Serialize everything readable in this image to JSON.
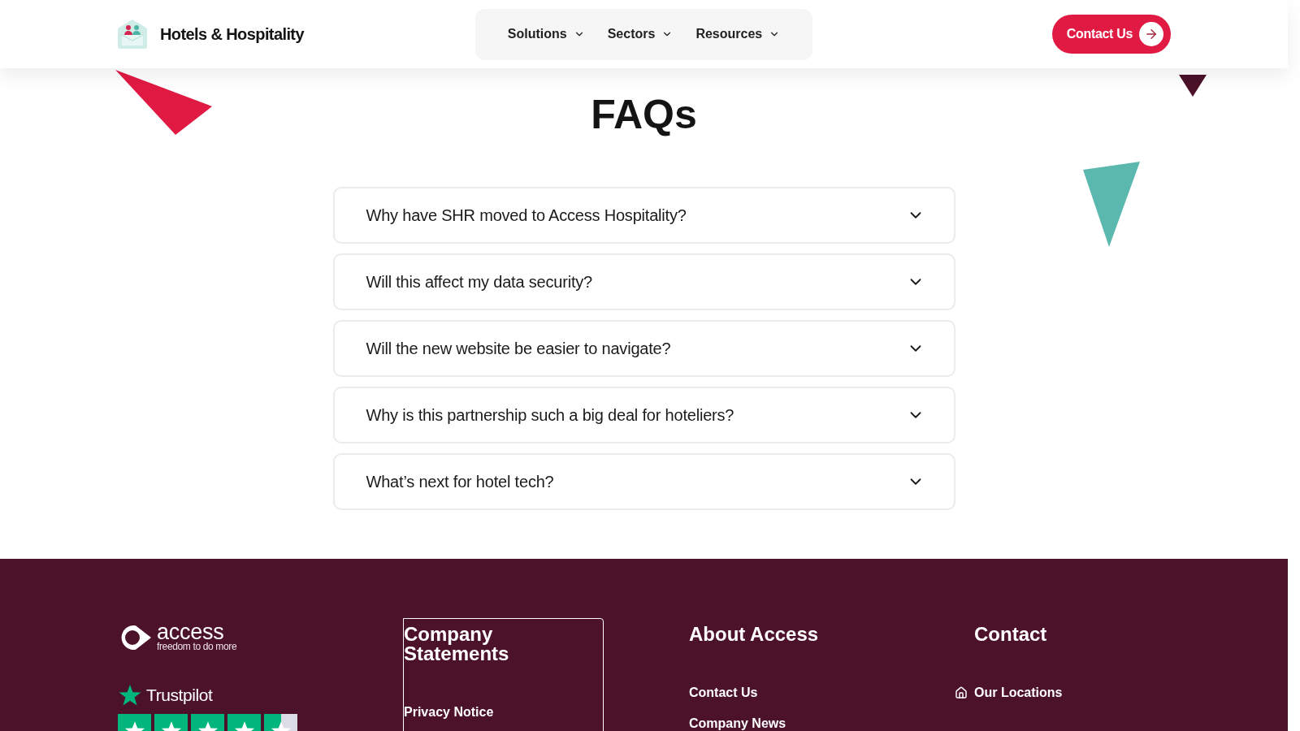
{
  "header": {
    "brand": "Hotels & Hospitality",
    "nav": [
      {
        "label": "Solutions"
      },
      {
        "label": "Sectors"
      },
      {
        "label": "Resources"
      }
    ],
    "cta": "Contact Us"
  },
  "faq": {
    "title": "FAQs",
    "items": [
      {
        "question": "Why have SHR moved to Access Hospitality?",
        "expanded": false
      },
      {
        "question": "Will this affect my data security?",
        "expanded": false
      },
      {
        "question": "Will the new website be easier to navigate?",
        "expanded": false
      },
      {
        "question": "Why is this partnership such a big deal for hoteliers?",
        "expanded": false
      },
      {
        "question": "What’s next for hotel tech?",
        "expanded": false
      }
    ]
  },
  "footer": {
    "brand": {
      "name": "access",
      "tagline": "freedom to do more"
    },
    "trustpilot": {
      "label": "Trustpilot",
      "stars": 4.5
    },
    "columns": [
      {
        "heading": "Company Statements",
        "focused": true,
        "links": [
          {
            "label": "Privacy Notice",
            "kind": "text"
          }
        ]
      },
      {
        "heading": "About Access",
        "focused": false,
        "links": [
          {
            "label": "Contact Us",
            "kind": "text"
          },
          {
            "label": "Company News",
            "kind": "text"
          }
        ]
      },
      {
        "heading": "Contact",
        "focused": false,
        "links": [
          {
            "label": "Our Locations",
            "kind": "location"
          }
        ]
      }
    ]
  }
}
